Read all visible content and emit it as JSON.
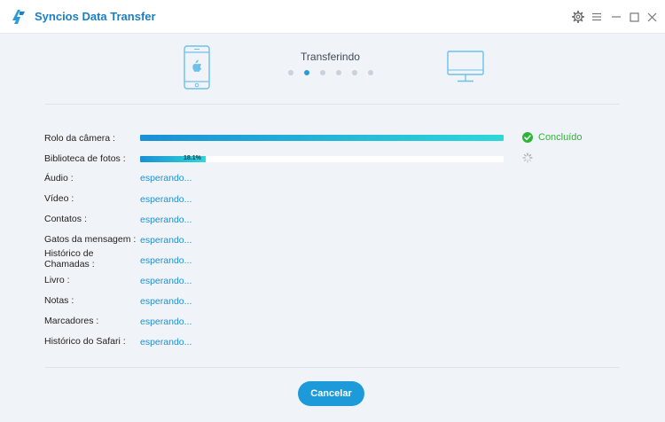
{
  "app": {
    "title": "Syncios Data Transfer",
    "logo_icon": "syncios-logo-icon",
    "accent_color": "#1c9ad9"
  },
  "window_controls": [
    "gear-icon",
    "menu-icon",
    "minimize-icon",
    "maximize-icon",
    "close-icon"
  ],
  "header": {
    "step_title": "Transferindo",
    "source_device_icon": "iphone-icon",
    "target_device_icon": "monitor-icon",
    "dots_total": 6,
    "dot_active_index": 1
  },
  "rows": [
    {
      "label": "Rolo da câmera :",
      "state": "done",
      "progress": 1.0,
      "status": "Concluído"
    },
    {
      "label": "Biblioteca de fotos :",
      "state": "progress",
      "progress": 0.181,
      "percent_text": "18.1%"
    },
    {
      "label": "Áudio :",
      "state": "waiting",
      "status": "esperando..."
    },
    {
      "label": "Vídeo :",
      "state": "waiting",
      "status": "esperando..."
    },
    {
      "label": "Contatos :",
      "state": "waiting",
      "status": "esperando..."
    },
    {
      "label": "Gatos da mensagem :",
      "state": "waiting",
      "status": "esperando..."
    },
    {
      "label": "Histórico de Chamadas :",
      "state": "waiting",
      "status": "esperando..."
    },
    {
      "label": "Livro :",
      "state": "waiting",
      "status": "esperando..."
    },
    {
      "label": "Notas :",
      "state": "waiting",
      "status": "esperando..."
    },
    {
      "label": "Marcadores :",
      "state": "waiting",
      "status": "esperando..."
    },
    {
      "label": "Histórico do Safari :",
      "state": "waiting",
      "status": "esperando..."
    }
  ],
  "footer": {
    "cancel_label": "Cancelar"
  }
}
